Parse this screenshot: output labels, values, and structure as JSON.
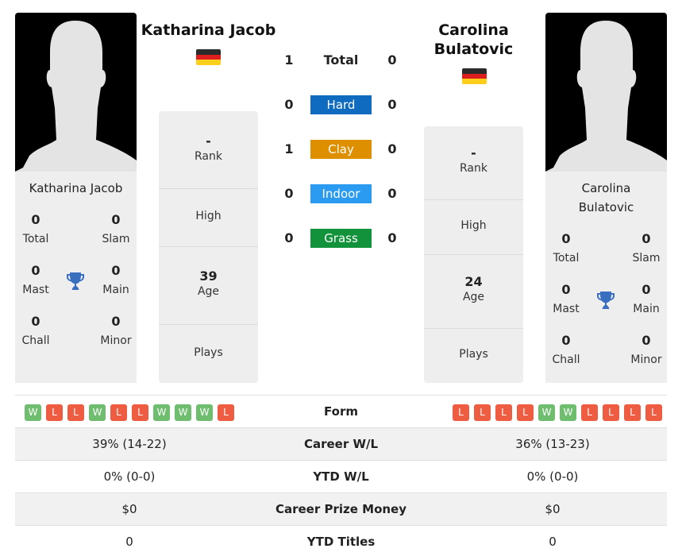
{
  "player1": {
    "name": "Katharina Jacob",
    "card_name": "Katharina Jacob",
    "flag_colors": [
      "#2b2b2b",
      "#dd1f1f",
      "#fdce1c"
    ],
    "titles": {
      "total": {
        "value": "0",
        "label": "Total"
      },
      "slam": {
        "value": "0",
        "label": "Slam"
      },
      "mast": {
        "value": "0",
        "label": "Mast"
      },
      "main": {
        "value": "0",
        "label": "Main"
      },
      "chall": {
        "value": "0",
        "label": "Chall"
      },
      "minor": {
        "value": "0",
        "label": "Minor"
      }
    },
    "info": {
      "rank": {
        "value": "-",
        "label": "Rank"
      },
      "high": {
        "value": "",
        "label": "High"
      },
      "age": {
        "value": "39",
        "label": "Age"
      },
      "plays": {
        "value": "",
        "label": "Plays"
      }
    },
    "form": [
      "W",
      "L",
      "L",
      "W",
      "L",
      "L",
      "W",
      "W",
      "W",
      "L"
    ]
  },
  "player2": {
    "name": "Carolina Bulatovic",
    "name_line1": "Carolina",
    "name_line2": "Bulatovic",
    "card_name_line1": "Carolina",
    "card_name_line2": "Bulatovic",
    "flag_colors": [
      "#2b2b2b",
      "#dd1f1f",
      "#fdce1c"
    ],
    "titles": {
      "total": {
        "value": "0",
        "label": "Total"
      },
      "slam": {
        "value": "0",
        "label": "Slam"
      },
      "mast": {
        "value": "0",
        "label": "Mast"
      },
      "main": {
        "value": "0",
        "label": "Main"
      },
      "chall": {
        "value": "0",
        "label": "Chall"
      },
      "minor": {
        "value": "0",
        "label": "Minor"
      }
    },
    "info": {
      "rank": {
        "value": "-",
        "label": "Rank"
      },
      "high": {
        "value": "",
        "label": "High"
      },
      "age": {
        "value": "24",
        "label": "Age"
      },
      "plays": {
        "value": "",
        "label": "Plays"
      }
    },
    "form": [
      "L",
      "L",
      "L",
      "L",
      "W",
      "W",
      "L",
      "L",
      "L",
      "L"
    ]
  },
  "h2h": [
    {
      "label": "Total",
      "p1": "1",
      "p2": "0",
      "color": null
    },
    {
      "label": "Hard",
      "p1": "0",
      "p2": "0",
      "color": "#0f6bbf"
    },
    {
      "label": "Clay",
      "p1": "1",
      "p2": "0",
      "color": "#de8f00"
    },
    {
      "label": "Indoor",
      "p1": "0",
      "p2": "0",
      "color": "#2a9bf0"
    },
    {
      "label": "Grass",
      "p1": "0",
      "p2": "0",
      "color": "#12923a"
    }
  ],
  "comparison": [
    {
      "label": "Form",
      "p1": "",
      "p2": ""
    },
    {
      "label": "Career W/L",
      "p1": "39% (14-22)",
      "p2": "36% (13-23)"
    },
    {
      "label": "YTD W/L",
      "p1": "0% (0-0)",
      "p2": "0% (0-0)"
    },
    {
      "label": "Career Prize Money",
      "p1": "$0",
      "p2": "$0"
    },
    {
      "label": "YTD Titles",
      "p1": "0",
      "p2": "0"
    }
  ],
  "colors": {
    "win": "#6fbe6f",
    "loss": "#ee5c42",
    "trophy": "#3a6fc0"
  }
}
